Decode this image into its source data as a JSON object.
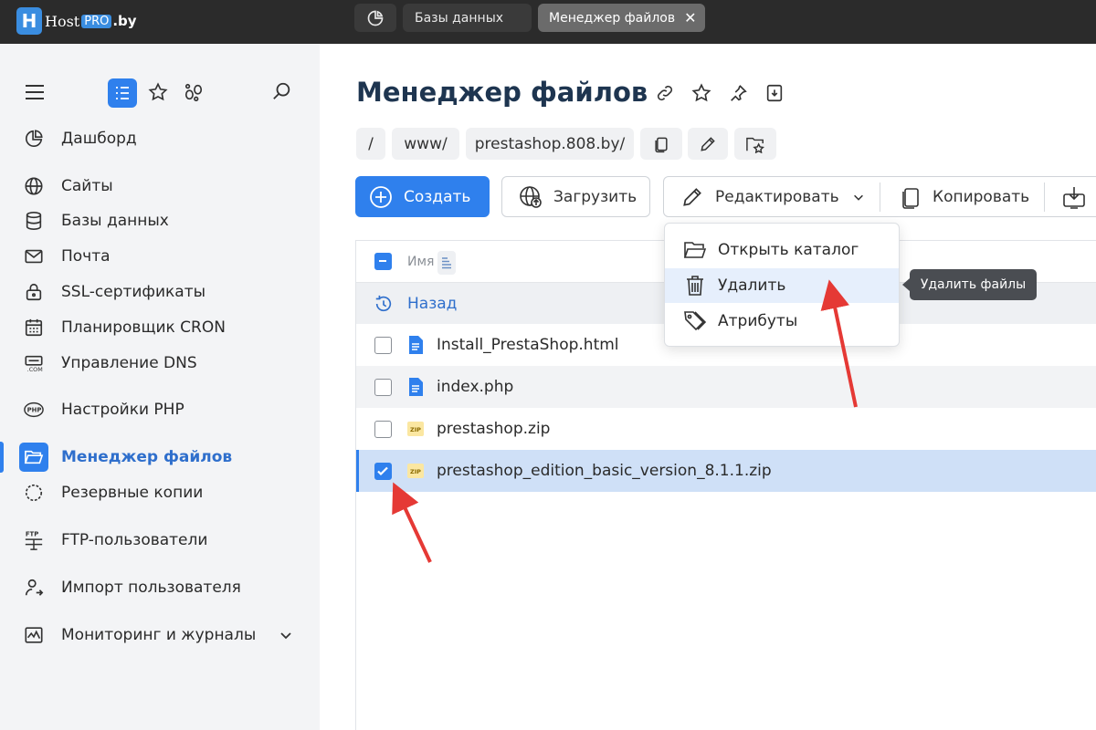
{
  "logo": {
    "host": "Host",
    "pro": "PRO",
    "by": ".by"
  },
  "topbar": {
    "tabs": [
      {
        "label": "Базы данных"
      },
      {
        "label": "Менеджер файлов"
      }
    ],
    "close_glyph": "✕"
  },
  "sidebar": {
    "items": [
      {
        "label": "Дашборд",
        "icon": "dashboard-icon"
      },
      {
        "label": "Сайты",
        "icon": "globe-icon"
      },
      {
        "label": "Базы данных",
        "icon": "database-icon"
      },
      {
        "label": "Почта",
        "icon": "mail-icon"
      },
      {
        "label": "SSL-сертификаты",
        "icon": "lock-icon"
      },
      {
        "label": "Планировщик CRON",
        "icon": "calendar-icon"
      },
      {
        "label": "Управление DNS",
        "icon": "dns-icon"
      },
      {
        "label": "Настройки PHP",
        "icon": "php-icon"
      },
      {
        "label": "Менеджер файлов",
        "icon": "folder-icon",
        "active": true
      },
      {
        "label": "Резервные копии",
        "icon": "backup-icon"
      },
      {
        "label": "FTP-пользователи",
        "icon": "ftp-icon"
      },
      {
        "label": "Импорт пользователя",
        "icon": "user-import-icon"
      },
      {
        "label": "Мониторинг и журналы",
        "icon": "monitoring-icon"
      }
    ]
  },
  "main": {
    "title": "Менеджер файлов",
    "breadcrumb": [
      "/",
      "www/",
      "prestashop.808.by/"
    ],
    "toolbar": {
      "create": "Создать",
      "upload": "Загрузить",
      "edit": "Редактировать",
      "copy": "Копировать"
    },
    "table": {
      "header_name": "Имя",
      "back": "Назад",
      "files": [
        {
          "name": "Install_PrestaShop.html",
          "type": "doc",
          "checked": false
        },
        {
          "name": "index.php",
          "type": "doc",
          "checked": false
        },
        {
          "name": "prestashop.zip",
          "type": "zip",
          "checked": false
        },
        {
          "name": "prestashop_edition_basic_version_8.1.1.zip",
          "type": "zip",
          "checked": true
        }
      ]
    },
    "dropdown": {
      "items": [
        "Открыть каталог",
        "Удалить",
        "Атрибуты"
      ]
    },
    "tooltip": "Удалить файлы",
    "zip_badge": "ZIP"
  },
  "colors": {
    "accent": "#2f80ed",
    "annotation": "#e53935",
    "topbar": "#2b2b2b"
  }
}
